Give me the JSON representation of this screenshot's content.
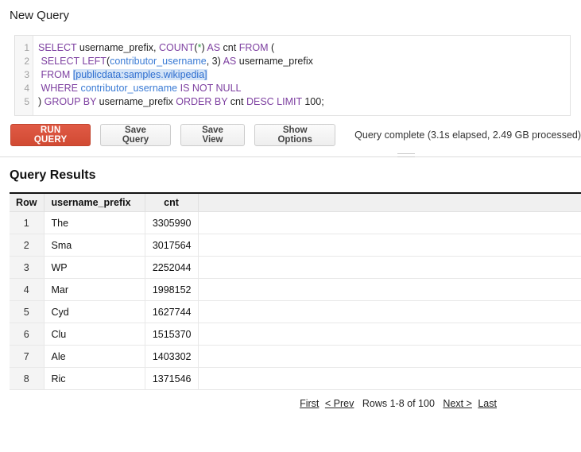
{
  "page": {
    "title": "New Query"
  },
  "editor": {
    "line_numbers": [
      "1",
      "2",
      "3",
      "4",
      "5"
    ],
    "lines": [
      [
        {
          "t": "SELECT",
          "c": "kw"
        },
        {
          "t": " username_prefix, ",
          "c": "txt"
        },
        {
          "t": "COUNT",
          "c": "kw"
        },
        {
          "t": "(",
          "c": "txt"
        },
        {
          "t": "*",
          "c": "star"
        },
        {
          "t": ") ",
          "c": "txt"
        },
        {
          "t": "AS",
          "c": "kw"
        },
        {
          "t": " cnt ",
          "c": "txt"
        },
        {
          "t": "FROM",
          "c": "kw"
        },
        {
          "t": " (",
          "c": "txt"
        }
      ],
      [
        {
          "t": " ",
          "c": "txt"
        },
        {
          "t": "SELECT",
          "c": "kw"
        },
        {
          "t": " ",
          "c": "txt"
        },
        {
          "t": "LEFT",
          "c": "kw"
        },
        {
          "t": "(",
          "c": "txt"
        },
        {
          "t": "contributor_username",
          "c": "id"
        },
        {
          "t": ", ",
          "c": "txt"
        },
        {
          "t": "3",
          "c": "num"
        },
        {
          "t": ") ",
          "c": "txt"
        },
        {
          "t": "AS",
          "c": "kw"
        },
        {
          "t": " username_prefix",
          "c": "txt"
        }
      ],
      [
        {
          "t": " ",
          "c": "txt"
        },
        {
          "t": "FROM",
          "c": "kw"
        },
        {
          "t": " ",
          "c": "txt"
        },
        {
          "t": "[publicdata:samples.wikipedia]",
          "c": "tbl"
        }
      ],
      [
        {
          "t": " ",
          "c": "txt"
        },
        {
          "t": "WHERE",
          "c": "kw"
        },
        {
          "t": " ",
          "c": "txt"
        },
        {
          "t": "contributor_username",
          "c": "id"
        },
        {
          "t": " ",
          "c": "txt"
        },
        {
          "t": "IS NOT NULL",
          "c": "kw"
        }
      ],
      [
        {
          "t": ") ",
          "c": "txt"
        },
        {
          "t": "GROUP BY",
          "c": "kw"
        },
        {
          "t": " username_prefix ",
          "c": "txt"
        },
        {
          "t": "ORDER BY",
          "c": "kw"
        },
        {
          "t": " cnt ",
          "c": "txt"
        },
        {
          "t": "DESC LIMIT",
          "c": "kw"
        },
        {
          "t": " ",
          "c": "txt"
        },
        {
          "t": "100",
          "c": "num"
        },
        {
          "t": ";",
          "c": "txt"
        }
      ]
    ]
  },
  "toolbar": {
    "run_label": "RUN QUERY",
    "save_query_label": "Save Query",
    "save_view_label": "Save View",
    "show_options_label": "Show Options",
    "status": "Query complete (3.1s elapsed, 2.49 GB processed)",
    "run_color": "#d9543f"
  },
  "results": {
    "heading": "Query Results",
    "columns": [
      "Row",
      "username_prefix",
      "cnt",
      ""
    ],
    "rows": [
      {
        "row": "1",
        "username_prefix": "The",
        "cnt": "3305990"
      },
      {
        "row": "2",
        "username_prefix": "Sma",
        "cnt": "3017564"
      },
      {
        "row": "3",
        "username_prefix": "WP",
        "cnt": "2252044"
      },
      {
        "row": "4",
        "username_prefix": "Mar",
        "cnt": "1998152"
      },
      {
        "row": "5",
        "username_prefix": "Cyd",
        "cnt": "1627744"
      },
      {
        "row": "6",
        "username_prefix": "Clu",
        "cnt": "1515370"
      },
      {
        "row": "7",
        "username_prefix": "Ale",
        "cnt": "1403302"
      },
      {
        "row": "8",
        "username_prefix": "Ric",
        "cnt": "1371546"
      }
    ]
  },
  "pagination": {
    "first": "First",
    "prev": "< Prev",
    "rows_label": "Rows 1-8 of 100",
    "next": "Next >",
    "last": "Last"
  }
}
